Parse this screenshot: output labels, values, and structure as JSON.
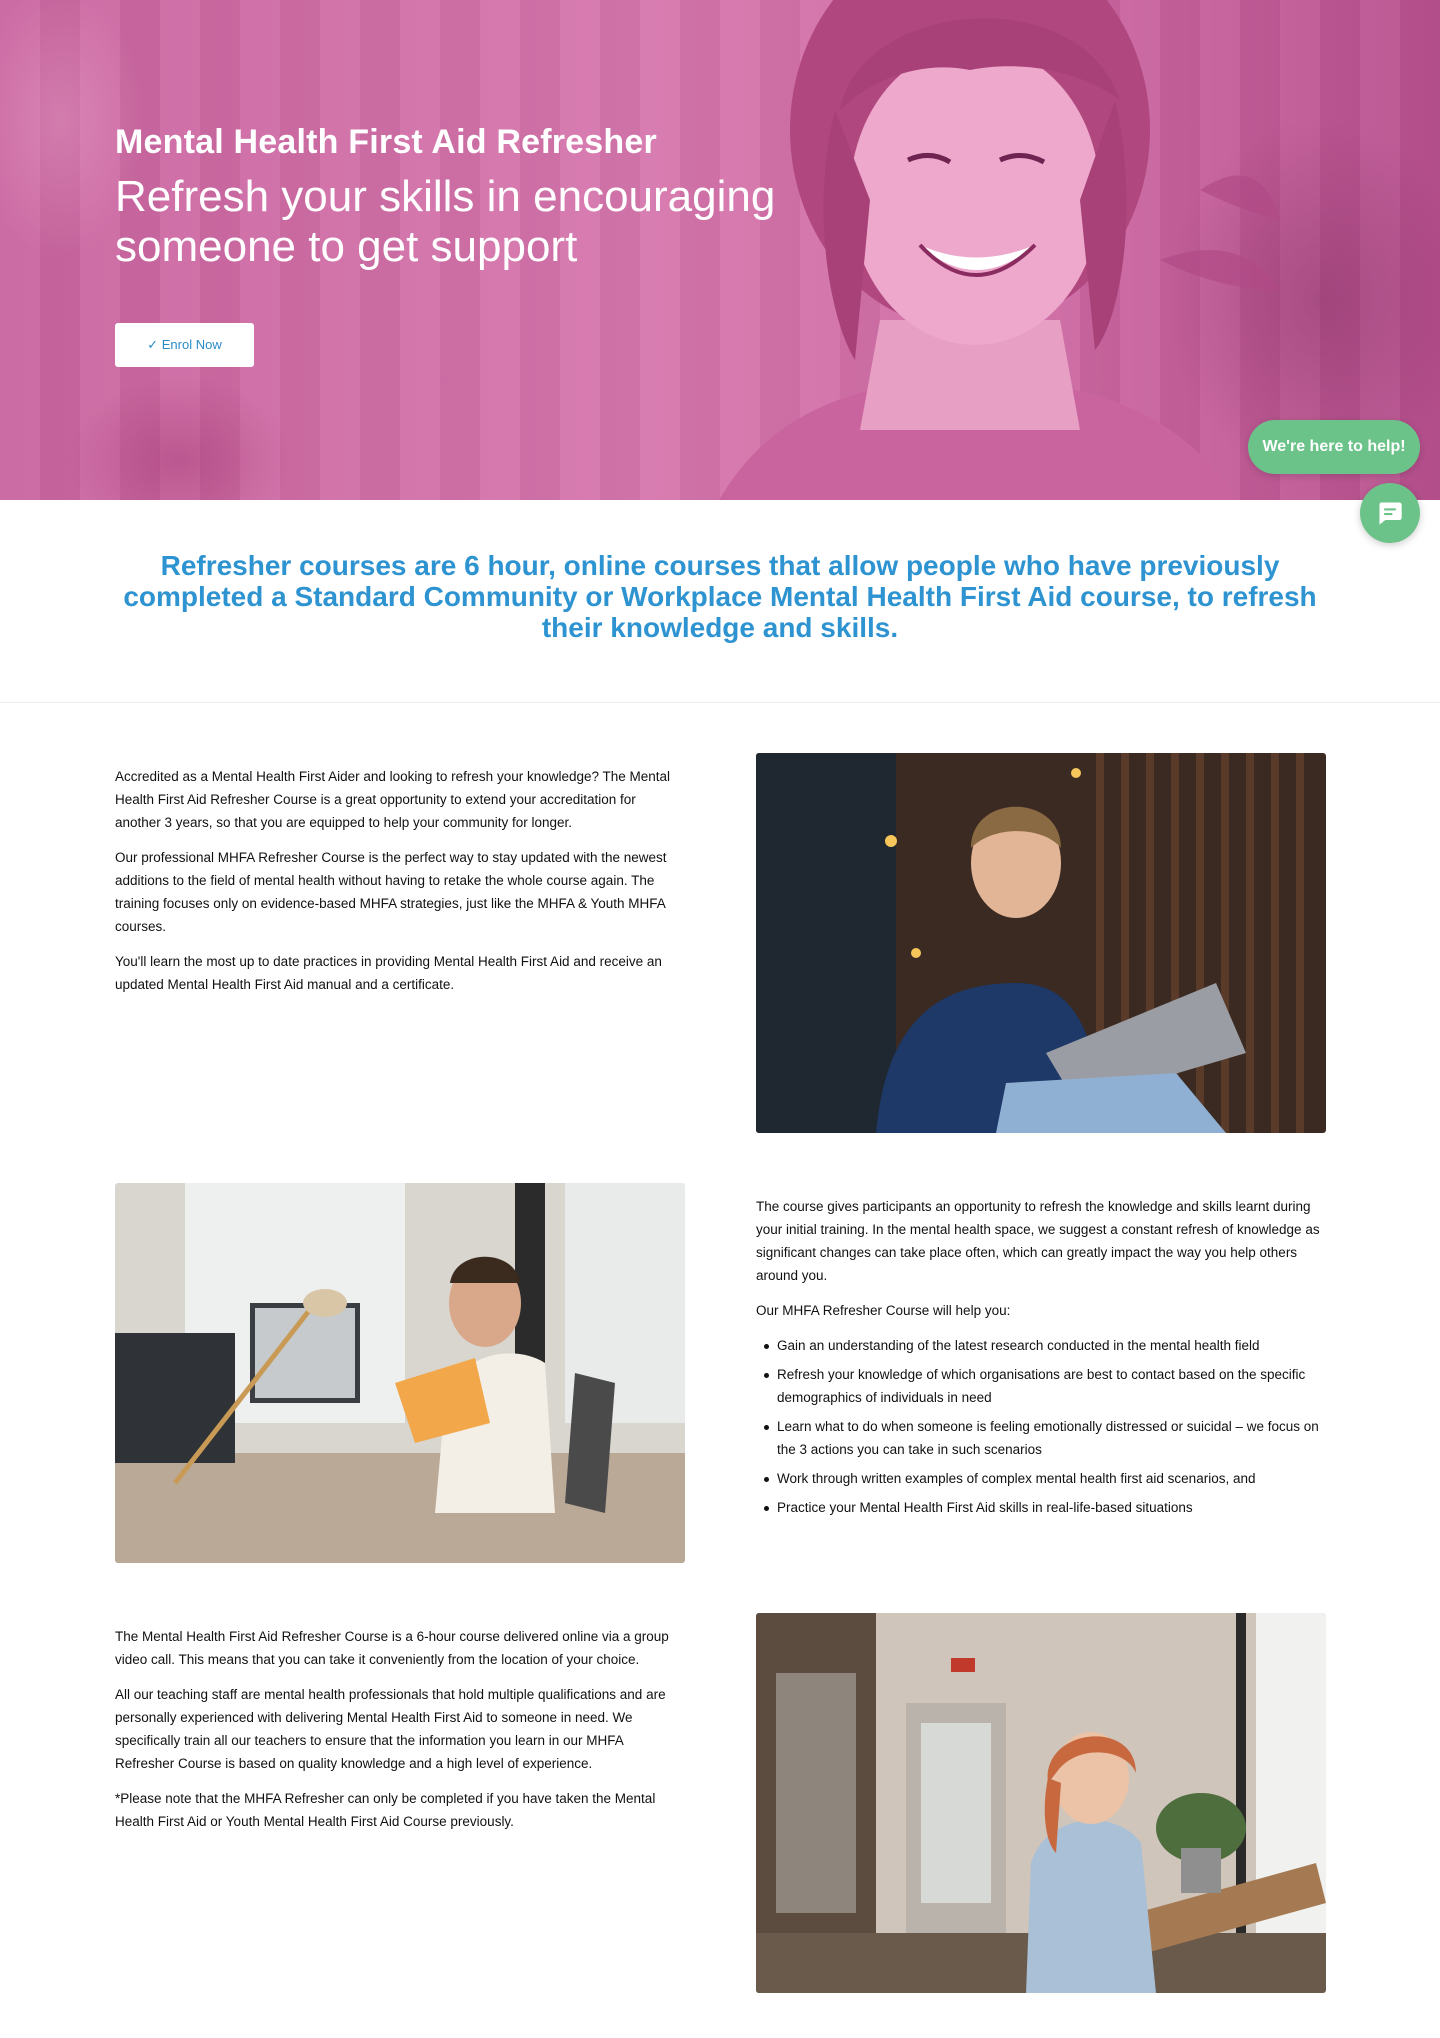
{
  "hero": {
    "title": "Mental Health First Aid Refresher",
    "subtitle": "Refresh your skills in encouraging someone to get support",
    "enrol_label": "✓ Enrol Now"
  },
  "help_widget": {
    "pill_label": "We're here to help!",
    "chat_icon": "chat-bubble-icon"
  },
  "intro": {
    "text": "Refresher courses are 6 hour, online courses that allow people who have previously completed a Standard Community or Workplace Mental Health First Aid course, to refresh their knowledge and skills."
  },
  "section1": {
    "paragraphs": [
      "Accredited as a Mental Health First Aider and looking to refresh your knowledge? The Mental Health First Aid Refresher Course is a great opportunity to extend your accreditation for another 3 years, so that you are equipped to help your community for longer.",
      "Our professional MHFA Refresher Course is the perfect way to stay updated with the newest additions to the field of mental health without having to retake the whole course again. The training focuses only on evidence-based MHFA strategies, just like the MHFA & Youth MHFA courses.",
      "You'll learn the most up to date practices in providing Mental Health First Aid and receive an updated Mental Health First Aid manual and a certificate."
    ]
  },
  "section2": {
    "paragraphs": [
      "The course gives participants an opportunity to refresh the knowledge and skills learnt during your initial training. In the mental health space, we suggest a constant refresh of knowledge as significant changes can take place often, which can greatly impact the way you help others around you.",
      "Our MHFA Refresher Course will help you:"
    ],
    "bullets": [
      "Gain an understanding of the latest research conducted in the mental health field",
      "Refresh your knowledge of which organisations are best to contact based on the specific demographics of individuals in need",
      "Learn what to do when someone is feeling emotionally distressed or suicidal – we focus on the 3 actions you can take in such scenarios",
      "Work through written examples of complex mental health first aid scenarios, and",
      "Practice your Mental Health First Aid skills in real-life-based situations"
    ]
  },
  "section3": {
    "paragraphs": [
      "The Mental Health First Aid Refresher Course is a 6-hour course delivered online via a group video call. This means that you can take it conveniently from the location of your choice.",
      "All our teaching staff are mental health professionals that hold multiple qualifications and are personally experienced with delivering Mental Health First Aid to someone in need. We specifically train all our teachers to ensure that the information you learn in our MHFA Refresher Course is based on quality knowledge and a high level of experience.",
      "*Please note that the MHFA Refresher can only be completed if you have taken the Mental Health First Aid or Youth Mental Health First Aid Course previously."
    ]
  },
  "colors": {
    "hero_overlay": "#d676ad",
    "accent_blue": "#2d93d1",
    "help_green": "#6cc389"
  }
}
